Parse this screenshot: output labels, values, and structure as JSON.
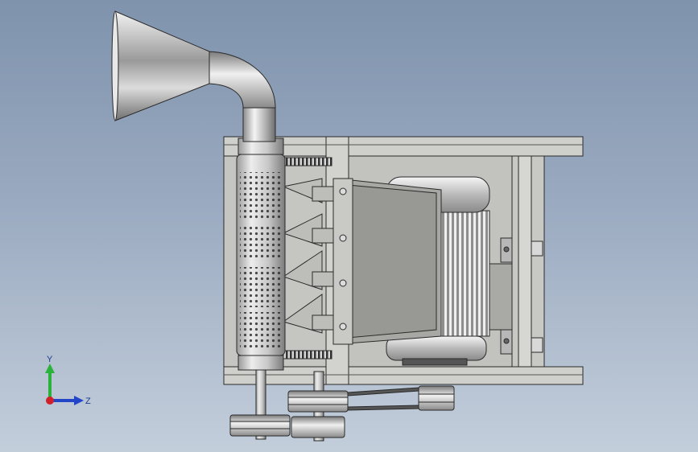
{
  "viewport": {
    "background_top": "#7f93ad",
    "background_bottom": "#c3cedb",
    "model_fill": "#c9c9c5",
    "model_stroke": "#2a2a2a"
  },
  "triad": {
    "y_label": "Y",
    "z_label": "Z",
    "y_color": "#29b33a",
    "z_color": "#2346c8",
    "x_color": "#d0212b"
  }
}
